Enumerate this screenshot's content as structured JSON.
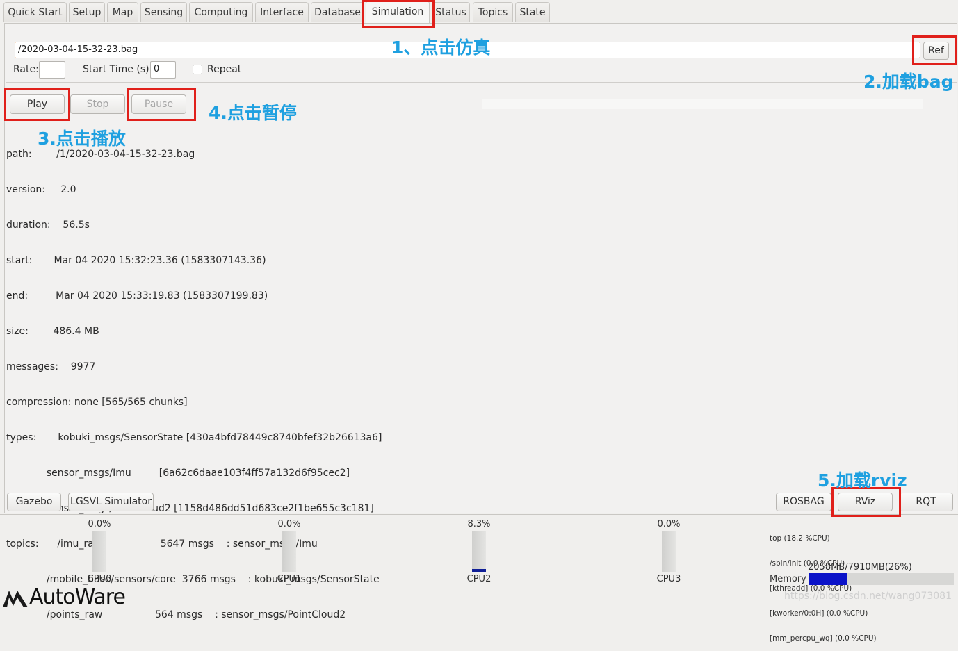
{
  "tabs": [
    {
      "label": "Quick Start",
      "active": false
    },
    {
      "label": "Setup",
      "active": false
    },
    {
      "label": "Map",
      "active": false
    },
    {
      "label": "Sensing",
      "active": false
    },
    {
      "label": "Computing",
      "active": false
    },
    {
      "label": "Interface",
      "active": false
    },
    {
      "label": "Database",
      "active": false
    },
    {
      "label": "Simulation",
      "active": true
    },
    {
      "label": "Status",
      "active": false
    },
    {
      "label": "Topics",
      "active": false
    },
    {
      "label": "State",
      "active": false
    }
  ],
  "bag": {
    "path_value": "/2020-03-04-15-32-23.bag",
    "ref_label": "Ref",
    "rate_label": "Rate:",
    "rate_value": "",
    "start_time_label": "Start Time (s):",
    "start_time_value": "0",
    "repeat_label": "Repeat",
    "repeat_checked": false
  },
  "controls": {
    "play": "Play",
    "stop": "Stop",
    "pause": "Pause",
    "progress": 0
  },
  "info_lines": [
    "path:        /1/2020-03-04-15-32-23.bag",
    "version:     2.0",
    "duration:    56.5s",
    "start:       Mar 04 2020 15:32:23.36 (1583307143.36)",
    "end:         Mar 04 2020 15:33:19.83 (1583307199.83)",
    "size:        486.4 MB",
    "messages:    9977",
    "compression: none [565/565 chunks]",
    "types:       kobuki_msgs/SensorState [430a4bfd78449c8740bfef32b26613a6]",
    "             sensor_msgs/Imu         [6a62c6daae103f4ff57a132d6f95cec2]",
    "             sensor_msgs/PointCloud2 [1158d486dd51d683ce2f1be655c3c181]",
    "topics:      /imu_raw                   5647 msgs    : sensor_msgs/Imu",
    "             /mobile_base/sensors/core  3766 msgs    : kobuki_msgs/SensorState",
    "             /points_raw                 564 msgs    : sensor_msgs/PointCloud2"
  ],
  "bottom_buttons": {
    "gazebo": "Gazebo",
    "lgsvl": "LGSVL Simulator",
    "rosbag": "ROSBAG",
    "rviz": "RViz",
    "rqt": "RQT"
  },
  "cpus": [
    {
      "name": "CPU0",
      "pct": "0.0%",
      "value": 0.0
    },
    {
      "name": "CPU1",
      "pct": "0.0%",
      "value": 0.0
    },
    {
      "name": "CPU2",
      "pct": "8.3%",
      "value": 8.3
    },
    {
      "name": "CPU3",
      "pct": "0.0%",
      "value": 0.0
    }
  ],
  "top_processes": [
    "top (18.2 %CPU)",
    "/sbin/init (0.0 %CPU)",
    "[kthreadd] (0.0 %CPU)",
    "[kworker/0:0H] (0.0 %CPU)",
    "[mm_percpu_wq] (0.0 %CPU)"
  ],
  "memory": {
    "label": "Memory",
    "text": "2058MB/7910MB(26%)",
    "percent": 26
  },
  "annotations": {
    "a1": "1、点击仿真",
    "a2": "2.加载bag",
    "a3": "3.点击播放",
    "a4": "4.点击暂停",
    "a5": "5.加载rviz"
  },
  "logo": "AutoWare",
  "watermark": "https://blog.csdn.net/wang073081",
  "colors": {
    "annotation": "#1fa0e0",
    "highlight_box": "#e0201b",
    "cpu_fill": "#0f1e96",
    "memory_fill": "#0a12c8"
  }
}
